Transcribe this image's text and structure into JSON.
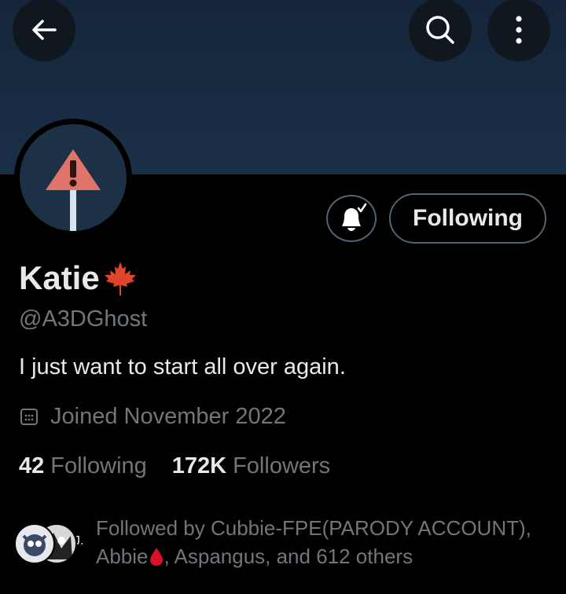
{
  "header": {
    "back_icon": "arrow-left-icon",
    "search_icon": "search-icon",
    "more_icon": "more-vertical-icon"
  },
  "profile": {
    "name": "Katie",
    "name_emoji": "maple-leaf-icon",
    "handle": "@A3DGhost",
    "bio": "I just want to start all over again.",
    "joined": "Joined November 2022",
    "following_count": "42",
    "following_label": "Following",
    "followers_count": "172K",
    "followers_label": "Followers"
  },
  "actions": {
    "notify_icon": "bell-check-icon",
    "following_button": "Following"
  },
  "followed_by": {
    "line1": "Followed by Cubbie-FPE(PARODY ACCOUNT),",
    "line2_name": "Abbie",
    "line2_rest": ", Aspangus, and 612 others"
  },
  "colors": {
    "background": "#000000",
    "banner": "#1b2f48",
    "primary_text": "#e7e9ea",
    "secondary_text": "#71767b",
    "border": "#536471",
    "warning_sign": "#e0736a"
  }
}
